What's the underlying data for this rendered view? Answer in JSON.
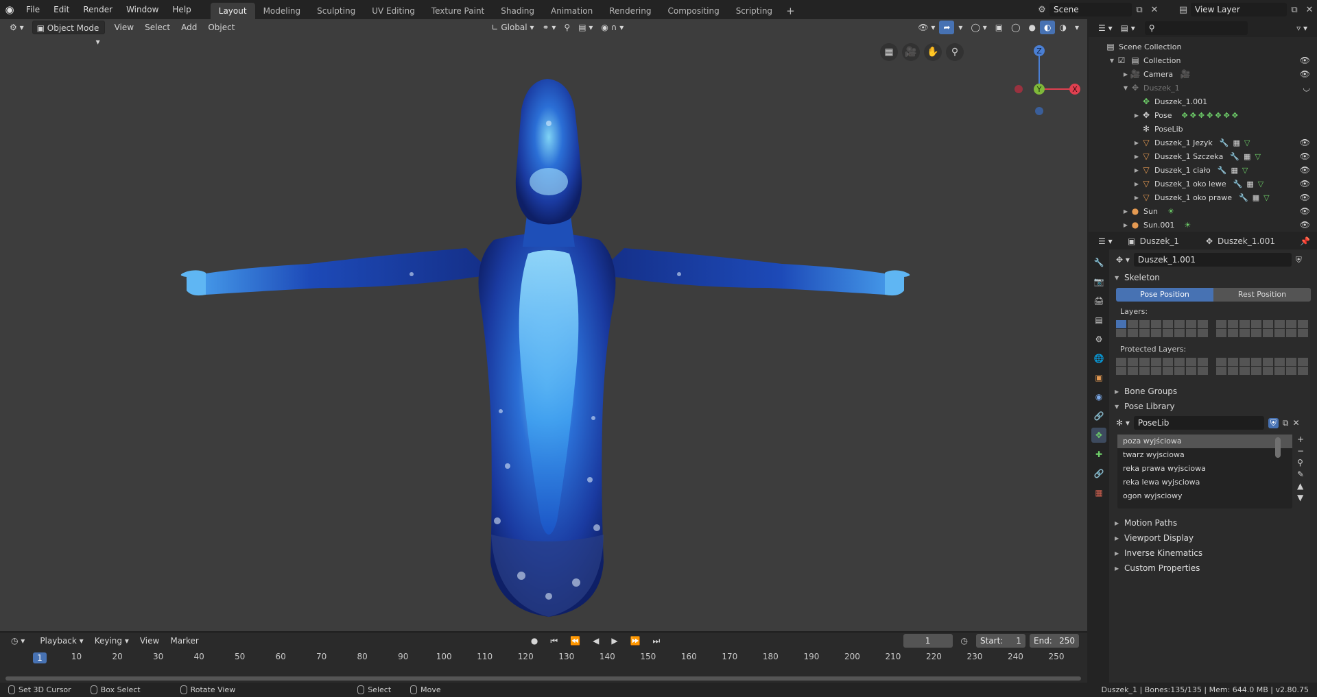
{
  "topbar": {
    "menu": [
      "File",
      "Edit",
      "Render",
      "Window",
      "Help"
    ],
    "workspaces": [
      "Layout",
      "Modeling",
      "Sculpting",
      "UV Editing",
      "Texture Paint",
      "Shading",
      "Animation",
      "Rendering",
      "Compositing",
      "Scripting"
    ],
    "active_workspace": "Layout",
    "add_tab": "+",
    "scene": "Scene",
    "view_layer": "View Layer"
  },
  "viewport": {
    "mode": "Object Mode",
    "menu": [
      "View",
      "Select",
      "Add",
      "Object"
    ],
    "orientation": "Global",
    "gizmo": {
      "z": "Z",
      "y": "Y",
      "x": "X"
    }
  },
  "timeline": {
    "menu": [
      "Playback",
      "Keying",
      "View",
      "Marker"
    ],
    "current_frame": "1",
    "start_label": "Start:",
    "start": "1",
    "end_label": "End:",
    "end": "250",
    "ticks": [
      "10",
      "20",
      "30",
      "40",
      "50",
      "60",
      "70",
      "80",
      "90",
      "100",
      "110",
      "120",
      "130",
      "140",
      "150",
      "160",
      "170",
      "180",
      "190",
      "200",
      "210",
      "220",
      "230",
      "240",
      "250"
    ],
    "current_marker": "1"
  },
  "statusbar": {
    "set_cursor": "Set 3D Cursor",
    "box_select": "Box Select",
    "rotate_view": "Rotate View",
    "select": "Select",
    "move": "Move",
    "stats": "Duszek_1 | Bones:135/135 | Mem: 644.0 MB | v2.80.75"
  },
  "outliner": {
    "root": "Scene Collection",
    "collection": "Collection",
    "camera": "Camera",
    "duszek": "Duszek_1",
    "armature": "Duszek_1.001",
    "pose": "Pose",
    "poselib": "PoseLib",
    "jezyk": "Duszek_1 Jezyk",
    "szczeka": "Duszek_1 Szczeka",
    "cialo": "Duszek_1 ciało",
    "oko_lewe": "Duszek_1 oko lewe",
    "oko_prawe": "Duszek_1 oko prawe",
    "sun": "Sun",
    "sun2": "Sun.001"
  },
  "properties": {
    "breadcrumb_object": "Duszek_1",
    "breadcrumb_data": "Duszek_1.001",
    "datablock": "Duszek_1.001",
    "skeleton": "Skeleton",
    "pose_position": "Pose Position",
    "rest_position": "Rest Position",
    "layers": "Layers:",
    "protected_layers": "Protected Layers:",
    "bone_groups": "Bone Groups",
    "pose_library": "Pose Library",
    "poselib_name": "PoseLib",
    "poses": [
      "poza wyjściowa",
      "twarz wyjsciowa",
      "reka prawa wyjsciowa",
      "reka lewa wyjsciowa",
      "ogon wyjsciowy"
    ],
    "motion_paths": "Motion Paths",
    "viewport_display": "Viewport Display",
    "inverse_kinematics": "Inverse Kinematics",
    "custom_properties": "Custom Properties"
  },
  "colors": {
    "accent": "#4772b3",
    "viewport_bg": "#3d3d3d",
    "panel_bg": "#2b2b2b"
  }
}
